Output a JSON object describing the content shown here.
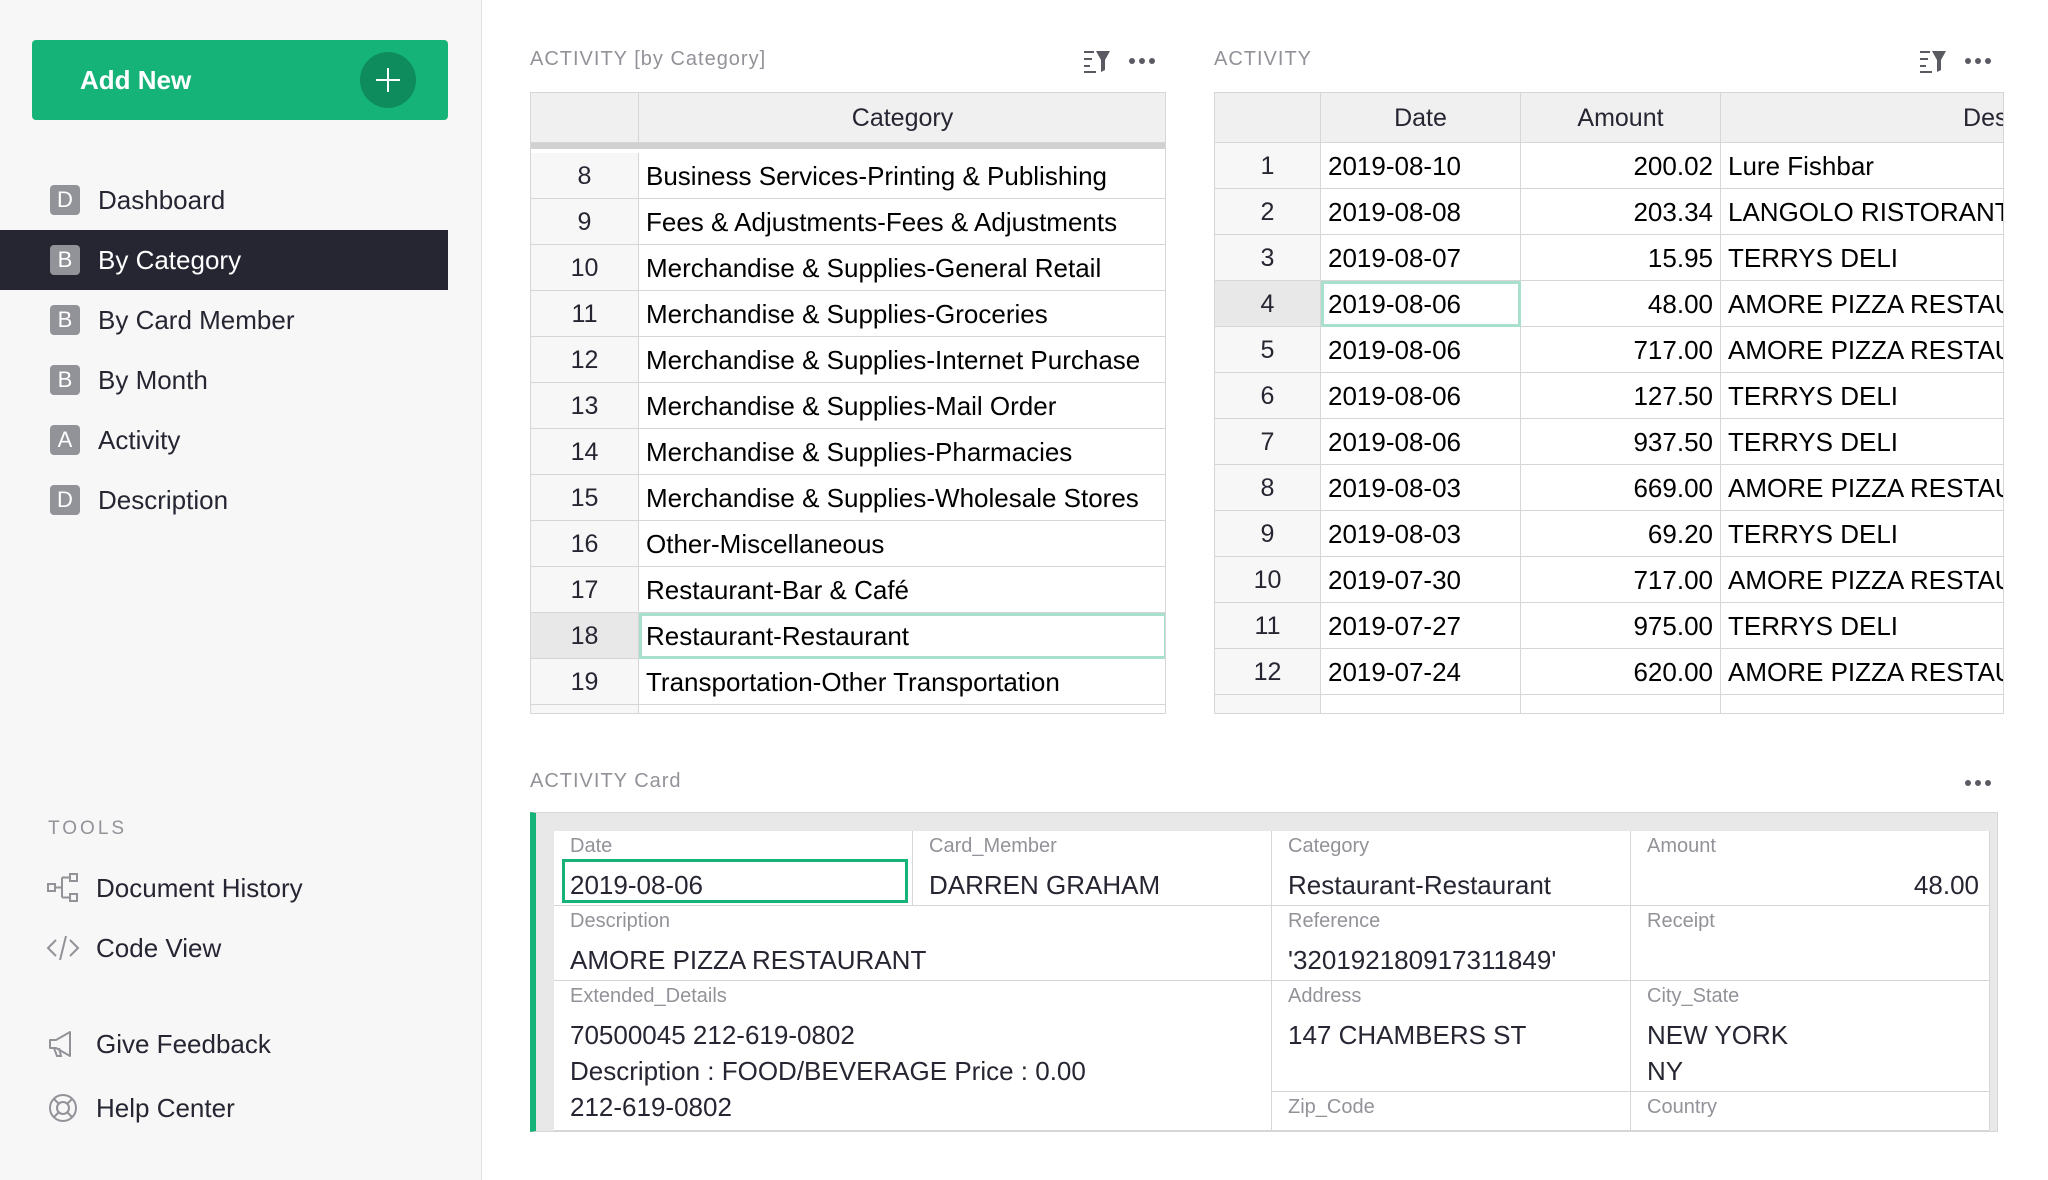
{
  "sidebar": {
    "add_new_label": "Add New",
    "pages": [
      {
        "badge": "D",
        "label": "Dashboard",
        "active": false
      },
      {
        "badge": "B",
        "label": "By Category",
        "active": true
      },
      {
        "badge": "B",
        "label": "By Card Member",
        "active": false
      },
      {
        "badge": "B",
        "label": "By Month",
        "active": false
      },
      {
        "badge": "A",
        "label": "Activity",
        "active": false
      },
      {
        "badge": "D",
        "label": "Description",
        "active": false
      }
    ],
    "tools_title": "TOOLS",
    "tools": [
      {
        "icon": "document-history-icon",
        "label": "Document History"
      },
      {
        "icon": "code-view-icon",
        "label": "Code View"
      },
      {
        "icon": "megaphone-icon",
        "label": "Give Feedback"
      },
      {
        "icon": "lifebuoy-icon",
        "label": "Help Center"
      }
    ]
  },
  "category_table": {
    "title": "ACTIVITY [by Category]",
    "column": "Category",
    "selected_row": "18",
    "rows": [
      {
        "n": "8",
        "category": "Business Services-Printing & Publishing"
      },
      {
        "n": "9",
        "category": "Fees & Adjustments-Fees & Adjustments"
      },
      {
        "n": "10",
        "category": "Merchandise & Supplies-General Retail"
      },
      {
        "n": "11",
        "category": "Merchandise & Supplies-Groceries"
      },
      {
        "n": "12",
        "category": "Merchandise & Supplies-Internet Purchase"
      },
      {
        "n": "13",
        "category": "Merchandise & Supplies-Mail Order"
      },
      {
        "n": "14",
        "category": "Merchandise & Supplies-Pharmacies"
      },
      {
        "n": "15",
        "category": "Merchandise & Supplies-Wholesale Stores"
      },
      {
        "n": "16",
        "category": "Other-Miscellaneous"
      },
      {
        "n": "17",
        "category": "Restaurant-Bar & Café"
      },
      {
        "n": "18",
        "category": "Restaurant-Restaurant"
      },
      {
        "n": "19",
        "category": "Transportation-Other Transportation"
      }
    ]
  },
  "activity_table": {
    "title": "ACTIVITY",
    "columns": [
      "Date",
      "Amount",
      "Desc"
    ],
    "selected_row": "4",
    "rows": [
      {
        "n": "1",
        "date": "2019-08-10",
        "amount": "200.02",
        "desc": "Lure Fishbar"
      },
      {
        "n": "2",
        "date": "2019-08-08",
        "amount": "203.34",
        "desc": "LANGOLO RISTORANTE"
      },
      {
        "n": "3",
        "date": "2019-08-07",
        "amount": "15.95",
        "desc": "TERRYS DELI"
      },
      {
        "n": "4",
        "date": "2019-08-06",
        "amount": "48.00",
        "desc": "AMORE PIZZA RESTAURANT"
      },
      {
        "n": "5",
        "date": "2019-08-06",
        "amount": "717.00",
        "desc": "AMORE PIZZA RESTAURANT"
      },
      {
        "n": "6",
        "date": "2019-08-06",
        "amount": "127.50",
        "desc": "TERRYS DELI"
      },
      {
        "n": "7",
        "date": "2019-08-06",
        "amount": "937.50",
        "desc": "TERRYS DELI"
      },
      {
        "n": "8",
        "date": "2019-08-03",
        "amount": "669.00",
        "desc": "AMORE PIZZA RESTAURANT"
      },
      {
        "n": "9",
        "date": "2019-08-03",
        "amount": "69.20",
        "desc": "TERRYS DELI"
      },
      {
        "n": "10",
        "date": "2019-07-30",
        "amount": "717.00",
        "desc": "AMORE PIZZA RESTAURANT"
      },
      {
        "n": "11",
        "date": "2019-07-27",
        "amount": "975.00",
        "desc": "TERRYS DELI"
      },
      {
        "n": "12",
        "date": "2019-07-24",
        "amount": "620.00",
        "desc": "AMORE PIZZA RESTAURANT"
      }
    ]
  },
  "card": {
    "title": "ACTIVITY Card",
    "fields": {
      "date": {
        "label": "Date",
        "value": "2019-08-06"
      },
      "card_member": {
        "label": "Card_Member",
        "value": "DARREN GRAHAM"
      },
      "category": {
        "label": "Category",
        "value": "Restaurant-Restaurant"
      },
      "amount": {
        "label": "Amount",
        "value": "48.00"
      },
      "description": {
        "label": "Description",
        "value": "AMORE PIZZA RESTAURANT"
      },
      "reference": {
        "label": "Reference",
        "value": "'320192180917311849'"
      },
      "receipt": {
        "label": "Receipt",
        "value": ""
      },
      "extended_details": {
        "label": "Extended_Details",
        "value": "70500045     212-619-0802\nDescription : FOOD/BEVERAGE Price : 0.00\n212-619-0802"
      },
      "address": {
        "label": "Address",
        "value": "147 CHAMBERS ST"
      },
      "city_state": {
        "label": "City_State",
        "value": "NEW YORK\nNY"
      },
      "zip_code": {
        "label": "Zip_Code",
        "value": ""
      },
      "country": {
        "label": "Country",
        "value": ""
      }
    }
  },
  "colors": {
    "accent": "#16b378",
    "sidebar_active": "#262633",
    "muted_text": "#929299"
  }
}
